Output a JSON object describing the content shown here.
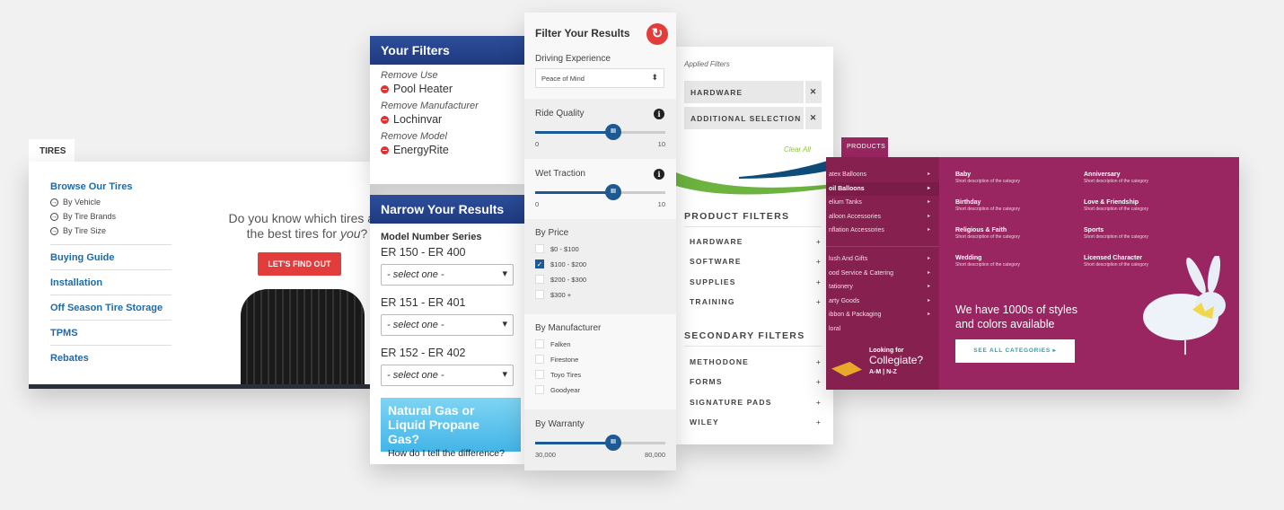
{
  "tires": {
    "tab": "TIRES",
    "browse": "Browse Our Tires",
    "sub": [
      "By Vehicle",
      "By Tire Brands",
      "By Tire Size"
    ],
    "links": [
      "Buying Guide",
      "Installation",
      "Off Season Tire Storage",
      "TPMS",
      "Rebates"
    ],
    "promo_line1": "Do you know which tires are",
    "promo_line2a": "the best tires for ",
    "promo_line2b": "you",
    "promo_line2c": "?",
    "cta": "LET'S FIND OUT"
  },
  "your_filters": {
    "title": "Your Filters",
    "items": [
      {
        "label": "Remove Use",
        "value": "Pool Heater"
      },
      {
        "label": "Remove Manufacturer",
        "value": "Lochinvar"
      },
      {
        "label": "Remove Model",
        "value": "EnergyRite"
      }
    ]
  },
  "narrow": {
    "title": "Narrow Your Results",
    "series_label": "Model Number Series",
    "groups": [
      {
        "range": "ER 150 - ER 400",
        "select": "- select one -"
      },
      {
        "range": "ER 151 - ER 401",
        "select": "- select one -"
      },
      {
        "range": "ER 152 - ER 402",
        "select": "- select one -"
      }
    ],
    "promo_big": "Natural Gas or Liquid Propane Gas?",
    "promo_small": "How do I tell the difference?"
  },
  "filter_results": {
    "title": "Filter Your Results",
    "driving_label": "Driving Experience",
    "driving_value": "Peace of Mind",
    "ride": {
      "label": "Ride Quality",
      "min": "0",
      "max": "10",
      "value": 6
    },
    "wet": {
      "label": "Wet Traction",
      "min": "0",
      "max": "10",
      "value": 6
    },
    "price": {
      "label": "By Price",
      "options": [
        {
          "label": "$0 - $100",
          "checked": false
        },
        {
          "label": "$100 - $200",
          "checked": true
        },
        {
          "label": "$200 - $300",
          "checked": false
        },
        {
          "label": "$300 +",
          "checked": false
        }
      ]
    },
    "manufacturer": {
      "label": "By Manufacturer",
      "options": [
        "Falken",
        "Firestone",
        "Toyo Tires",
        "Goodyear"
      ]
    },
    "warranty": {
      "label": "By Warranty",
      "min": "30,000",
      "max": "80,000",
      "value": 60000
    },
    "accent": "#1d5a94"
  },
  "applied": {
    "label": "Applied Filters",
    "chips": [
      "HARDWARE",
      "ADDITIONAL SELECTION"
    ],
    "clear": "Clear All",
    "product_heading": "PRODUCT FILTERS",
    "product_items": [
      "HARDWARE",
      "SOFTWARE",
      "SUPPLIES",
      "TRAINING"
    ],
    "secondary_heading": "SECONDARY FILTERS",
    "secondary_items": [
      "METHODONE",
      "FORMS",
      "SIGNATURE PADS",
      "WILEY"
    ]
  },
  "products": {
    "tab": "PRODUCTS",
    "menu1": [
      "atex Balloons",
      "oil Balloons",
      "elium Tanks",
      "alloon Accessories",
      "nflation Accessories"
    ],
    "menu2": [
      "lush And Gifts",
      "ood Service & Catering",
      "tationery",
      "arty Goods",
      "ibbon & Packaging",
      "loral"
    ],
    "categories": [
      {
        "name": "Baby",
        "desc": "Short description of the category"
      },
      {
        "name": "Anniversary",
        "desc": "Short description of the category"
      },
      {
        "name": "Birthday",
        "desc": "Short description of the category"
      },
      {
        "name": "Love & Friendship",
        "desc": "Short description of the category"
      },
      {
        "name": "Religious & Faith",
        "desc": "Short description of the category"
      },
      {
        "name": "Sports",
        "desc": "Short description of the category"
      },
      {
        "name": "Wedding",
        "desc": "Short description of the category"
      },
      {
        "name": "Licensed Character",
        "desc": "Short description of the category"
      }
    ],
    "tagline1": "We have 1000s of styles",
    "tagline2": "and colors available",
    "see_all": "SEE ALL CATEGORIES ▸",
    "coll_a": "Looking for",
    "coll_b": "Collegiate?",
    "coll_c": "A-M | N-Z",
    "brand": "#9a2661"
  }
}
